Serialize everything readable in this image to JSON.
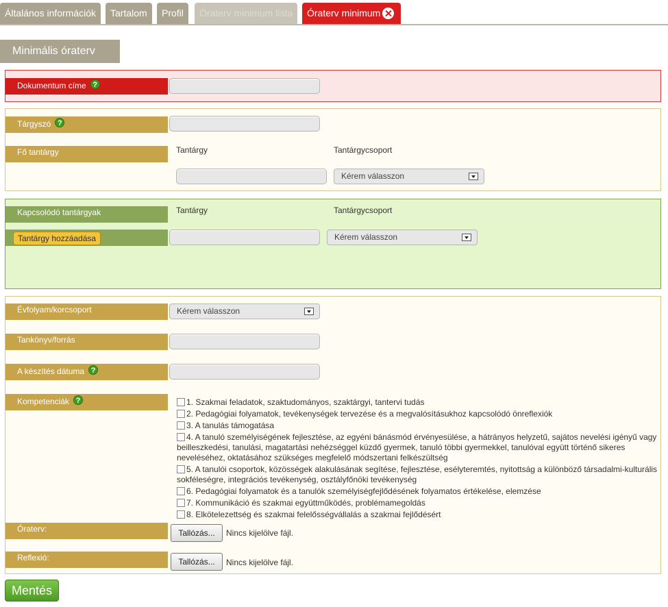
{
  "tabs": [
    {
      "label": "Általános információk"
    },
    {
      "label": "Tartalom"
    },
    {
      "label": "Profil"
    },
    {
      "label": "Óraterv minimum lista"
    },
    {
      "label": "Óraterv minimum"
    }
  ],
  "section_title": "Minimális óraterv",
  "document_title": {
    "label": "Dokumentum címe",
    "value": ""
  },
  "subject_keyword": {
    "label": "Tárgyszó",
    "value": ""
  },
  "main_subject": {
    "label": "Fő tantárgy",
    "subject_header": "Tantárgy",
    "group_header": "Tantárgycsoport",
    "subject_value": "",
    "group_selected": "Kérem válasszon"
  },
  "related_subjects": {
    "label": "Kapcsolódó tantárgyak",
    "subject_header": "Tantárgy",
    "group_header": "Tantárgycsoport",
    "add_button": "Tantárgy hozzáadása",
    "subject_value": "",
    "group_selected": "Kérem válasszon"
  },
  "grade": {
    "label": "Évfolyam/korcsoport",
    "selected": "Kérem válasszon"
  },
  "textbook": {
    "label": "Tankönyv/forrás",
    "value": ""
  },
  "created_date": {
    "label": "A készítés dátuma",
    "value": ""
  },
  "competencies": {
    "label": "Kompetenciák",
    "items": [
      "1. Szakmai feladatok, szaktudományos, szaktárgyi, tantervi tudás",
      "2. Pedagógiai folyamatok, tevékenységek tervezése és a megvalósításukhoz kapcsolódó önreflexiók",
      "3. A tanulás támogatása",
      "4. A tanuló személyiségének fejlesztése, az egyéni bánásmód érvényesülése, a hátrányos helyzetű, sajátos nevelési igényű vagy beilleszkedési, tanulási, magatartási nehézséggel küzdő gyermek, tanuló többi gyermekkel, tanulóval együtt történő sikeres neveléséhez, oktatásához szükséges megfelelő módszertani felkészültség",
      "5. A tanulói csoportok, közösségek alakulásának segítése, fejlesztése, esélyteremtés, nyitottság a különböző társadalmi-kulturális sokféleségre, integrációs tevékenység, osztályfőnöki tevékenység",
      "6. Pedagógiai folyamatok és a tanulók személyiségfejlődésének folyamatos értékelése, elemzése",
      "7. Kommunikáció és szakmai együttműködés, problémamegoldás",
      "8. Elkötelezettség és szakmai felelősségvállalás a szakmai fejlődésért"
    ]
  },
  "lesson_plan_file": {
    "label": "Óraterv:",
    "button": "Tallózás...",
    "status": "Nincs kijelölve fájl."
  },
  "reflection_file": {
    "label": "Reflexió:",
    "button": "Tallózás...",
    "status": "Nincs kijelölve fájl."
  },
  "save_button": "Mentés",
  "colors": {
    "accent_red": "#d81e1e",
    "label_tan": "#c7a449",
    "label_green": "#8aa659",
    "tab_gray": "#a9a38f",
    "save_green": "#5aa82f"
  }
}
